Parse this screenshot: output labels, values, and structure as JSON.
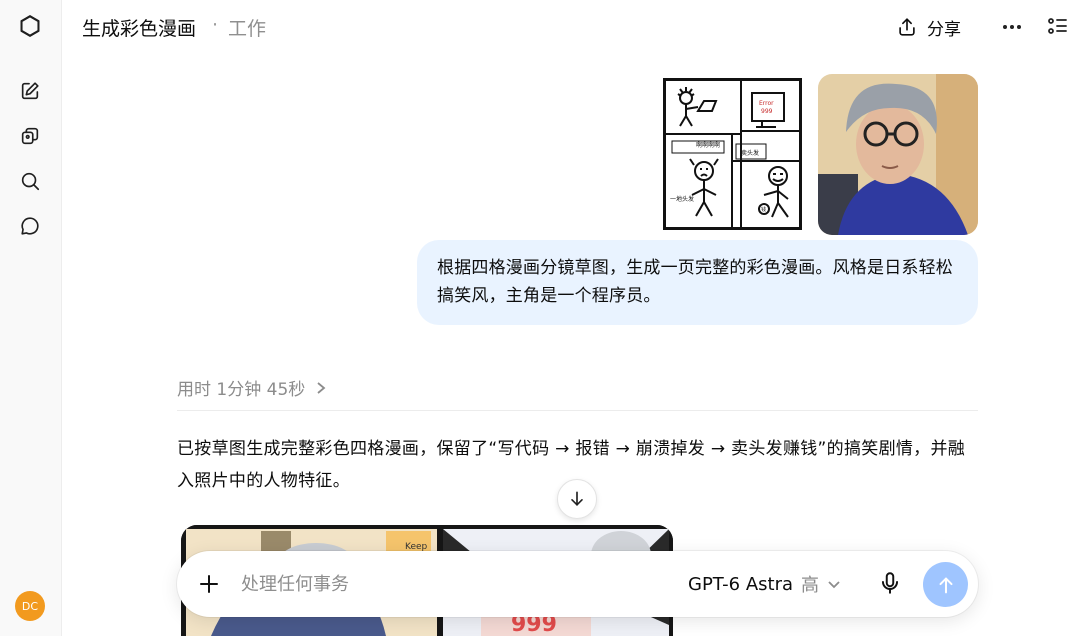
{
  "header": {
    "title": "生成彩色漫画",
    "separator": "·",
    "folder": "工作",
    "share_label": "分享"
  },
  "sidebar": {
    "icons": [
      "openai-logo-icon",
      "new-chat-icon",
      "library-icon",
      "search-icon",
      "chat-bubble-icon"
    ],
    "user_initials": "DC",
    "avatar_color": "#f29a1f"
  },
  "user_message": {
    "text": "根据四格漫画分镜草图，生成一页完整的彩色漫画。风格是日系轻松搞笑风，主角是一个程序员。",
    "sketch_labels": {
      "error_code": "Error 999",
      "panel3_shout": "啊啊啊啊",
      "panel3_caption": "一地头发",
      "panel4_sign": "卖头发",
      "panel4_coin": "钱"
    }
  },
  "assistant": {
    "thought_label": "用时 1分钟 45秒",
    "answer_text": "已按草图生成完整彩色四格漫画，保留了“写代码 → 报错 → 崩溃掉发 → 卖头发赚钱”的搞笑剧情，并融入照片中的人物特征。",
    "comic_labels": {
      "sign": "Keep",
      "error_code": "999"
    }
  },
  "composer": {
    "placeholder": "处理任何事务",
    "model_name": "GPT-6 Astra",
    "model_level": "高"
  },
  "colors": {
    "user_bubble": "#e9f3ff",
    "send_button": "#9fc5ff",
    "sidebar_bg": "#f9f9f9"
  }
}
